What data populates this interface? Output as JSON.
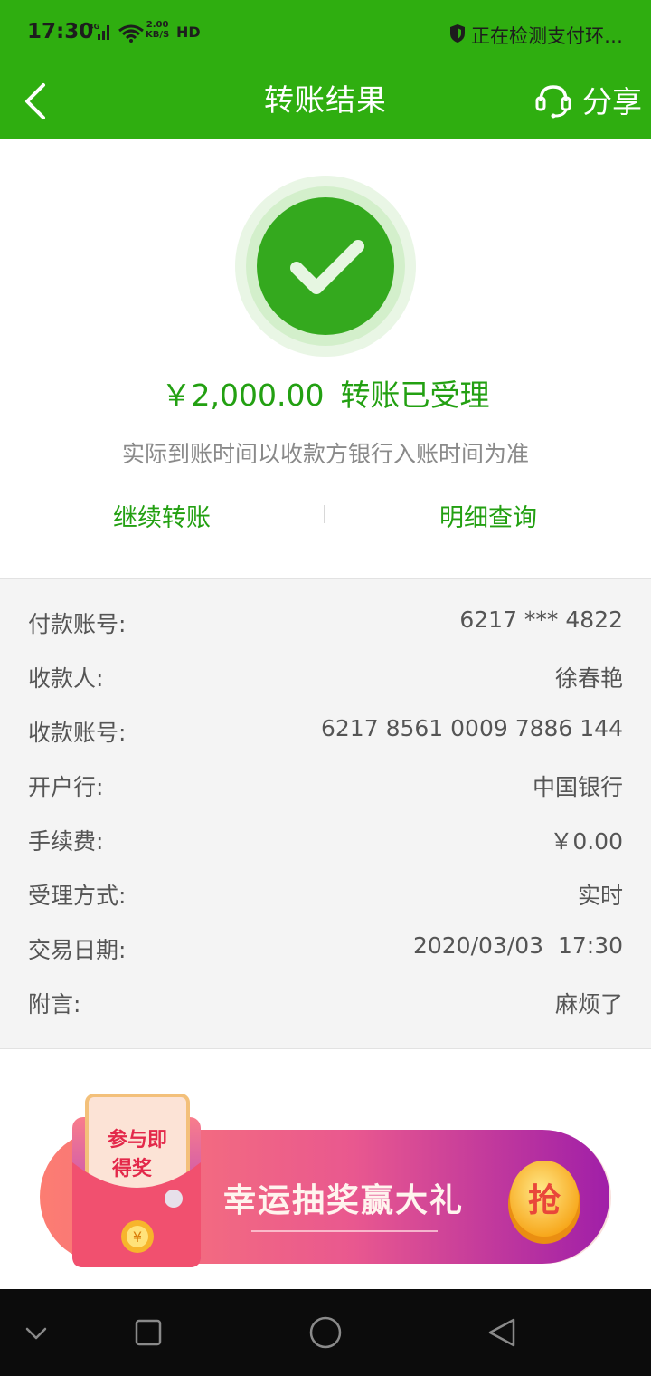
{
  "status_bar": {
    "time": "17:30",
    "network": "4G",
    "speed_value": "2.00",
    "speed_unit": "KB/S",
    "hd": "HD",
    "right_text": "正在检测支付环…"
  },
  "nav": {
    "title": "转账结果",
    "share_label": "分享"
  },
  "result": {
    "amount": "￥2,000.00",
    "status": "转账已受理",
    "note": "实际到账时间以收款方银行入账时间为准",
    "continue_label": "继续转账",
    "detail_label": "明细查询"
  },
  "details": [
    {
      "label": "付款账号:",
      "value": "6217 *** 4822"
    },
    {
      "label": "收款人:",
      "value": "徐春艳"
    },
    {
      "label": "收款账号:",
      "value": "6217 8561 0009 7886 144"
    },
    {
      "label": "开户行:",
      "value": "中国银行"
    },
    {
      "label": "手续费:",
      "value": "￥0.00"
    },
    {
      "label": "受理方式:",
      "value": "实时"
    },
    {
      "label": "交易日期:",
      "value": "2020/03/03  17:30"
    },
    {
      "label": "附言:",
      "value": "麻烦了"
    }
  ],
  "banner": {
    "badge_line1": "参与即",
    "badge_line2": "得奖",
    "headline": "幸运抽奖赢大礼",
    "grab": "抢"
  },
  "colors": {
    "brand_green": "#2fae10",
    "accent_green": "#23a012",
    "details_bg": "#f4f4f4"
  },
  "icons": {
    "back": "chevron-left-icon",
    "share": "headset-icon",
    "check": "check-circle-icon",
    "nav_down": "chevron-down-icon",
    "nav_recent": "square-icon",
    "nav_home": "circle-icon",
    "nav_back": "triangle-back-icon"
  }
}
